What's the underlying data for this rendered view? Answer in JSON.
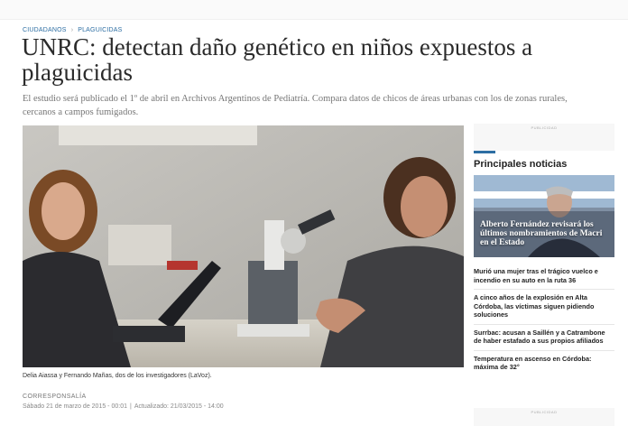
{
  "breadcrumb": {
    "section": "CIUDADANOS",
    "separator": "›",
    "topic": "PLAGUICIDAS"
  },
  "article": {
    "headline": "UNRC: detectan daño genético en niños expuestos a plaguicidas",
    "summary": "El estudio será publicado el 1º de abril en Archivos Argentinos de Pediatría. Compara datos de chicos de áreas urbanas con los de zonas rurales, cercanos a campos fumigados.",
    "photo_caption": "Delia Aiassa y Fernando Mañas, dos de los investigadores (LaVoz).",
    "byline": "CORRESPONSALÍA",
    "published": "Sábado 21 de marzo de 2015 - 00:01",
    "divider": "|",
    "updated": "Actualizado: 21/03/2015 - 14:00"
  },
  "ads": {
    "label": "PUBLICIDAD"
  },
  "sidebar": {
    "title": "Principales noticias",
    "accent_color": "#2d6ea3",
    "feature": {
      "headline": "Alberto Fernández revisará los últimos nombramientos de Macri en el Estado"
    },
    "items": [
      {
        "label": "Murió una mujer tras el trágico vuelco e incendio en su auto en la ruta 36"
      },
      {
        "label": "A cinco años de la explosión en Alta Córdoba, las víctimas siguen pidiendo soluciones"
      },
      {
        "label": "Surrbac: acusan a Saillén y a Catrambone de haber estafado a sus propios afiliados"
      },
      {
        "label": "Temperatura en ascenso en Córdoba: máxima de 32°"
      }
    ]
  },
  "icons": {
    "breadcrumb_separator": "chevron-right-icon"
  }
}
